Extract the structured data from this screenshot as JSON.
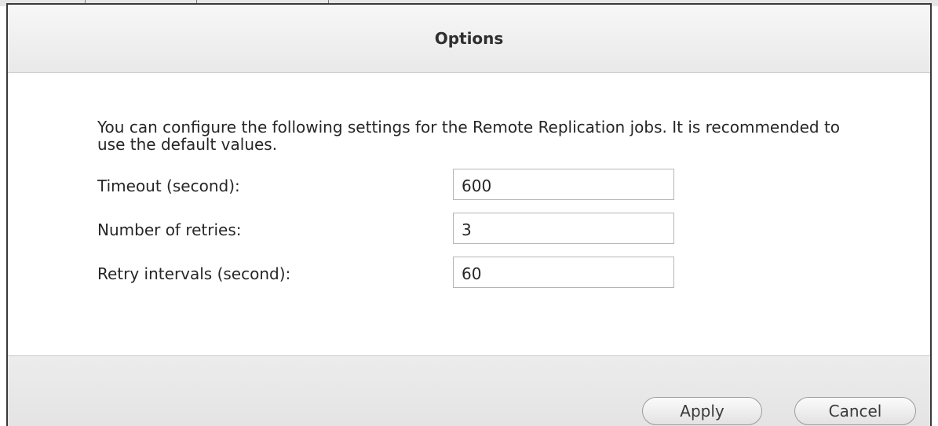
{
  "dialog": {
    "title": "Options",
    "description": "You can configure the following settings for the Remote Replication jobs. It is recommended to use the default values.",
    "fields": [
      {
        "label": "Timeout (second):",
        "value": "600"
      },
      {
        "label": "Number of retries:",
        "value": "3"
      },
      {
        "label": "Retry intervals (second):",
        "value": "60"
      }
    ],
    "buttons": {
      "apply_label": "Apply",
      "cancel_label": "Cancel"
    }
  },
  "colors": {
    "titlebar_bg": "#efefef",
    "footer_bg": "#e8e8e8",
    "border": "#3a3a3a",
    "text": "#262626"
  }
}
